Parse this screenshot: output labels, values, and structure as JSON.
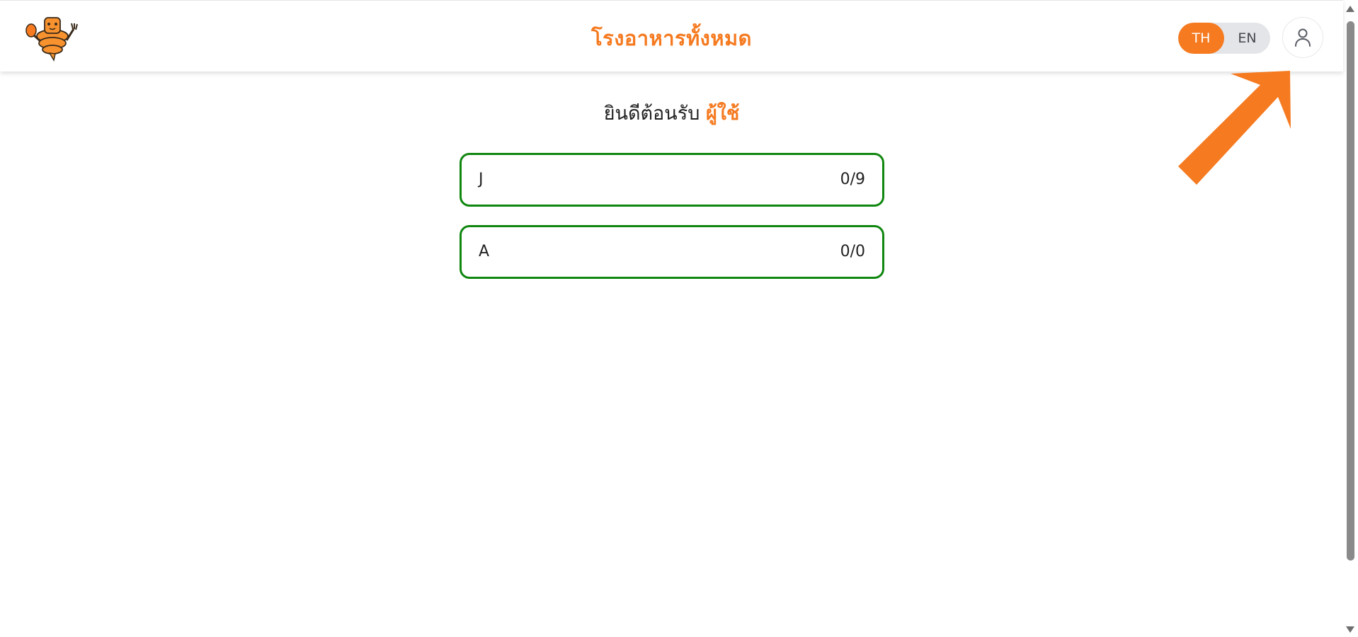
{
  "header": {
    "title": "โรงอาหารทั้งหมด",
    "logo_icon": "mascot-logo-icon",
    "lang_toggle": {
      "options": [
        "TH",
        "EN"
      ],
      "selected": "TH"
    },
    "profile_icon": "user-icon"
  },
  "welcome": {
    "prefix": "ยินดีต้อนรับ",
    "user": "ผู้ใช้"
  },
  "cafeterias": [
    {
      "name": "J",
      "count": "0/9"
    },
    {
      "name": "A",
      "count": "0/0"
    }
  ],
  "annotation": {
    "icon": "arrow-pointer-icon",
    "color": "#f57a20"
  },
  "colors": {
    "accent": "#f57a20",
    "card_border": "#10870f",
    "toggle_bg": "#e4e5e9"
  }
}
